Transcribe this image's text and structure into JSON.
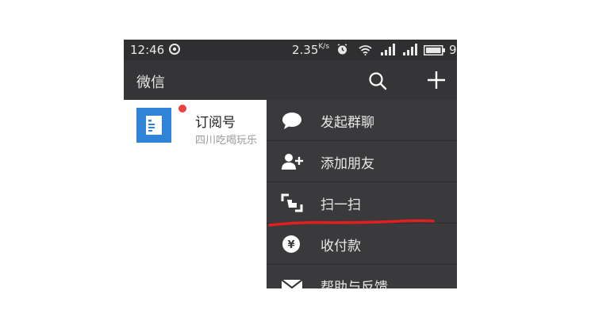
{
  "status_bar": {
    "time": "12:46",
    "speed": "2.35",
    "speed_unit": "K/s",
    "battery_text": "9"
  },
  "header": {
    "title": "微信"
  },
  "chat_list": {
    "items": [
      {
        "name": "订阅号",
        "preview": "四川吃喝玩乐",
        "unread_dot": true
      }
    ]
  },
  "menu": {
    "items": [
      {
        "icon": "chat-bubble-icon",
        "label": "发起群聊"
      },
      {
        "icon": "add-friend-icon",
        "label": "添加朋友"
      },
      {
        "icon": "scan-icon",
        "label": "扫一扫"
      },
      {
        "icon": "payment-icon",
        "label": "收付款"
      },
      {
        "icon": "mail-icon",
        "label": "帮助与反馈"
      }
    ]
  },
  "colors": {
    "status_bar_bg": "#2f2f31",
    "header_bg": "#353537",
    "menu_bg": "#3a3a3c",
    "avatar_blue": "#2f84d8",
    "unread_red": "#f04141",
    "annotation_red": "#e02020"
  }
}
